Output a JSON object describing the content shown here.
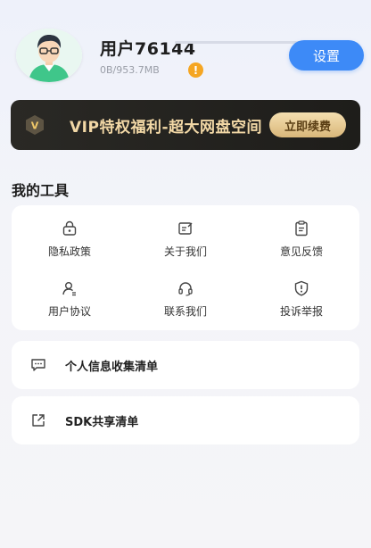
{
  "profile": {
    "username": "用户76144",
    "storage": "0B/953.7MB",
    "usage_fraction": 0,
    "warning_symbol": "!"
  },
  "header": {
    "settings_label": "设置"
  },
  "vip": {
    "badge_letter": "V",
    "text": "VIP特权福利-超大网盘空间",
    "renew_label": "立即续费"
  },
  "tools": {
    "title": "我的工具",
    "items": [
      {
        "label": "隐私政策",
        "icon": "lock-icon"
      },
      {
        "label": "关于我们",
        "icon": "edit-doc-icon"
      },
      {
        "label": "意见反馈",
        "icon": "feedback-icon"
      },
      {
        "label": "用户协议",
        "icon": "user-icon"
      },
      {
        "label": "联系我们",
        "icon": "headset-icon"
      },
      {
        "label": "投诉举报",
        "icon": "report-icon"
      }
    ]
  },
  "list": [
    {
      "label": "个人信息收集清单",
      "icon": "message-icon"
    },
    {
      "label": "SDK共享清单",
      "icon": "share-icon"
    }
  ],
  "colors": {
    "accent": "#3d8af7",
    "vip_bg": "#1e1d1a",
    "vip_gold": "#f2d8a6",
    "warning": "#f5a623"
  }
}
